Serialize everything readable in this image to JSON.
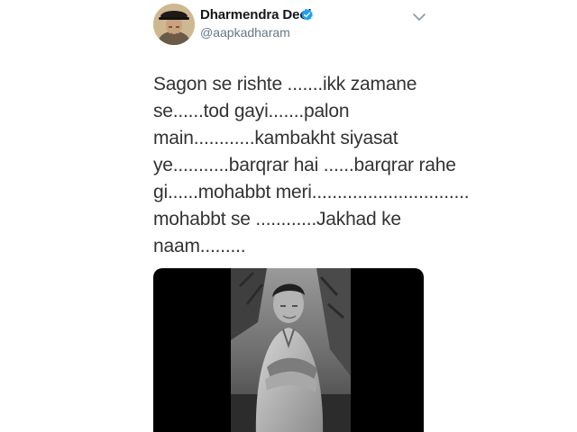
{
  "tweet": {
    "author": {
      "display_name": "Dharmendra Deol",
      "handle": "@aapkadharam",
      "verified": true,
      "avatar_icon": "profile-photo"
    },
    "menu_icon": "chevron-down-icon",
    "text_lines": [
      "Sagon se rishte .......ikk zamane",
      "se......tod gayi.......palon",
      "main............kambakht siyasat",
      "ye...........barqrar hai ......barqrar rahe",
      "gi......mohabbt meri...............................",
      "mohabbt se ............Jakhad ke",
      "naam........."
    ],
    "media": {
      "type": "photo",
      "description_icon": "black-and-white-photo"
    }
  },
  "colors": {
    "verified_blue": "#1da1f2",
    "handle_gray": "#657786",
    "text": "#333333",
    "media_background": "#000000"
  }
}
